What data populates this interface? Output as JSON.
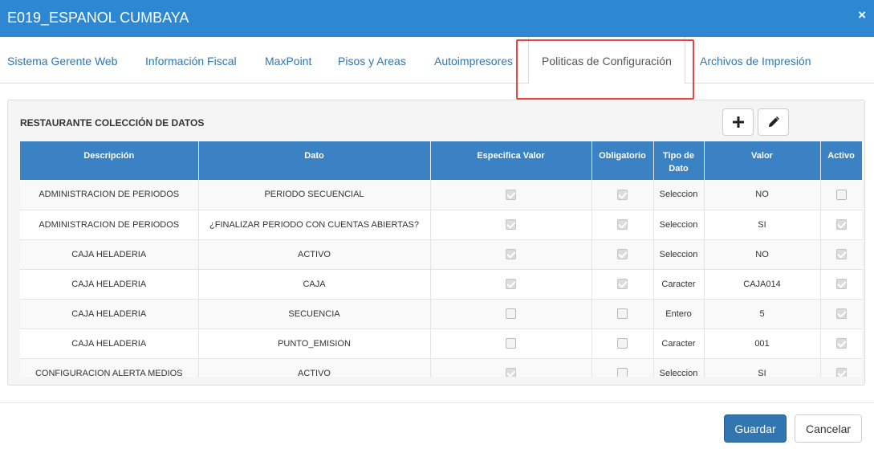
{
  "window": {
    "title": "E019_ESPANOL CUMBAYA",
    "close_label": "×"
  },
  "tabs": [
    {
      "label": "Sistema Gerente Web"
    },
    {
      "label": "Información Fiscal"
    },
    {
      "label": "MaxPoint"
    },
    {
      "label": "Pisos y Areas"
    },
    {
      "label": "Autoimpresores"
    },
    {
      "label": "Politicas de Configuración",
      "active": true
    },
    {
      "label": "Archivos de Impresión"
    }
  ],
  "panel": {
    "title": "RESTAURANTE COLECCIÓN DE DATOS",
    "add_icon": "plus-icon",
    "edit_icon": "pencil-icon"
  },
  "table": {
    "headers": [
      "Descripción",
      "Dato",
      "Especifica Valor",
      "Obligatorio",
      "Tipo de Dato",
      "Valor",
      "Activo"
    ],
    "rows": [
      {
        "descripcion": "ADMINISTRACION DE PERIODOS",
        "dato": "PERIODO SECUENCIAL",
        "especifica": true,
        "obligatorio": true,
        "tipo": "Seleccion",
        "valor": "NO",
        "activo": false
      },
      {
        "descripcion": "ADMINISTRACION DE PERIODOS",
        "dato": "¿FINALIZAR PERIODO CON CUENTAS ABIERTAS?",
        "especifica": true,
        "obligatorio": true,
        "tipo": "Seleccion",
        "valor": "SI",
        "activo": true
      },
      {
        "descripcion": "CAJA HELADERIA",
        "dato": "ACTIVO",
        "especifica": true,
        "obligatorio": true,
        "tipo": "Seleccion",
        "valor": "NO",
        "activo": true
      },
      {
        "descripcion": "CAJA HELADERIA",
        "dato": "CAJA",
        "especifica": true,
        "obligatorio": true,
        "tipo": "Caracter",
        "valor": "CAJA014",
        "activo": true
      },
      {
        "descripcion": "CAJA HELADERIA",
        "dato": "SECUENCIA",
        "especifica": false,
        "obligatorio": false,
        "tipo": "Entero",
        "valor": "5",
        "activo": true
      },
      {
        "descripcion": "CAJA HELADERIA",
        "dato": "PUNTO_EMISION",
        "especifica": false,
        "obligatorio": false,
        "tipo": "Caracter",
        "valor": "001",
        "activo": true
      },
      {
        "descripcion": "CONFIGURACION ALERTA MEDIOS",
        "dato": "ACTIVO",
        "especifica": true,
        "obligatorio": false,
        "tipo": "Seleccion",
        "valor": "SI",
        "activo": true
      }
    ]
  },
  "footer": {
    "save_label": "Guardar",
    "cancel_label": "Cancelar"
  },
  "colors": {
    "header_blue": "#2e87d1",
    "table_header": "#3a82c4",
    "primary_button": "#3276b1",
    "highlight_border": "#e04848"
  }
}
